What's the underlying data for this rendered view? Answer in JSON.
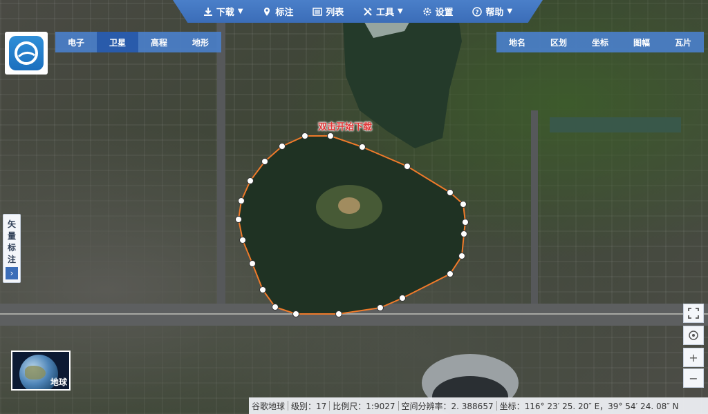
{
  "toolbar": {
    "download": "下载",
    "mark": "标注",
    "list": "列表",
    "tools": "工具",
    "settings": "设置",
    "help": "帮助"
  },
  "layers": [
    "电子",
    "卫星",
    "高程",
    "地形"
  ],
  "active_layer": "卫星",
  "info_tabs": [
    "地名",
    "区划",
    "坐标",
    "图幅",
    "瓦片"
  ],
  "side_label": [
    "矢",
    "量",
    "标",
    "注"
  ],
  "callout": "双击开始下载",
  "globe_label": "地球",
  "status": {
    "source": "谷歌地球",
    "level": "级别：17",
    "scale": "比例尺：1:9027",
    "resolution": "空间分辨率：2. 388657",
    "coords": "坐标：116° 23′ 25. 20″ E，39° 54′ 24. 08″ N"
  },
  "colors": {
    "toolbar": "#3b6db8",
    "polygon": "#f07a2a",
    "callout": "#e03838"
  }
}
